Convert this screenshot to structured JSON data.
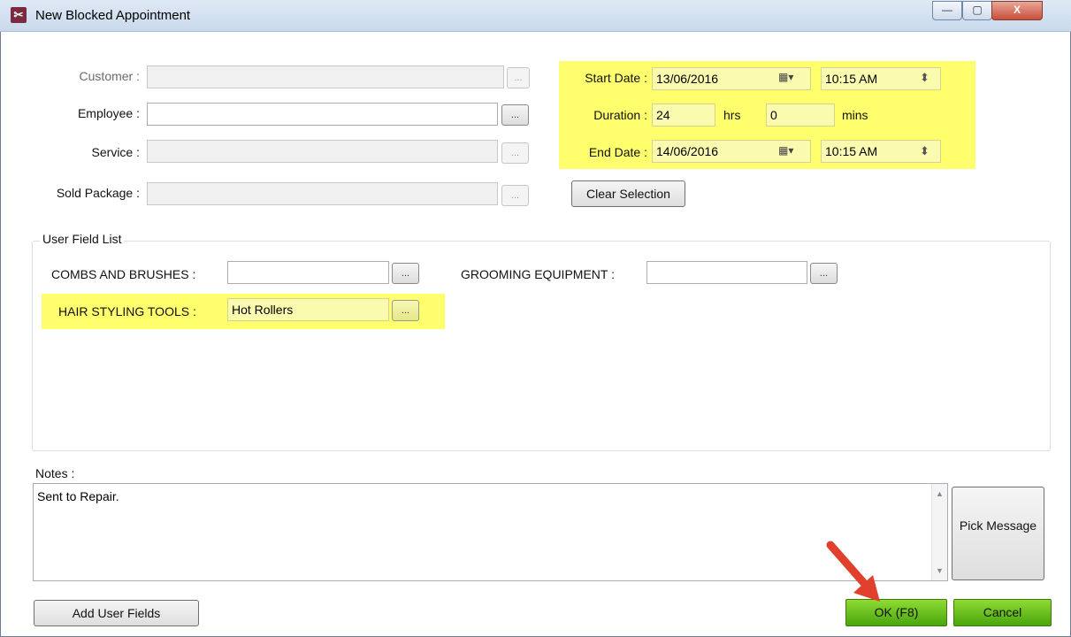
{
  "window": {
    "title": "New Blocked Appointment",
    "app_icon": "scissors-icon",
    "controls": {
      "minimize": "—",
      "maximize": "▢",
      "close": "X"
    }
  },
  "fields": {
    "customer_label": "Customer :",
    "employee_label": "Employee :",
    "service_label": "Service :",
    "sold_package_label": "Sold Package :",
    "ellipsis": "..."
  },
  "schedule": {
    "start_date_label": "Start Date :",
    "start_date": "13/06/2016",
    "start_time": "10:15 AM",
    "duration_label": "Duration :",
    "duration_hrs": "24",
    "hrs_label": "hrs",
    "duration_mins": "0",
    "mins_label": "mins",
    "end_date_label": "End Date :",
    "end_date": "14/06/2016",
    "end_time": "10:15 AM",
    "calendar_glyph": "▦▾",
    "spin_glyph": "⬍",
    "clear_selection": "Clear Selection"
  },
  "user_fields": {
    "group_title": "User Field List",
    "combs_label": "COMBS AND BRUSHES :",
    "combs_value": "",
    "grooming_label": "GROOMING EQUIPMENT :",
    "grooming_value": "",
    "hair_label": "HAIR STYLING TOOLS :",
    "hair_value": "Hot Rollers"
  },
  "notes": {
    "label": "Notes :",
    "value": "Sent to Repair.",
    "pick_message": "Pick Message",
    "scroll_up": "▲",
    "scroll_down": "▼"
  },
  "footer": {
    "add_user_fields": "Add User Fields",
    "ok": "OK (F8)",
    "cancel": "Cancel"
  },
  "colors": {
    "highlight": "#ffff6e",
    "ok_green": "#5fbf16",
    "arrow_red": "#e0402c"
  }
}
